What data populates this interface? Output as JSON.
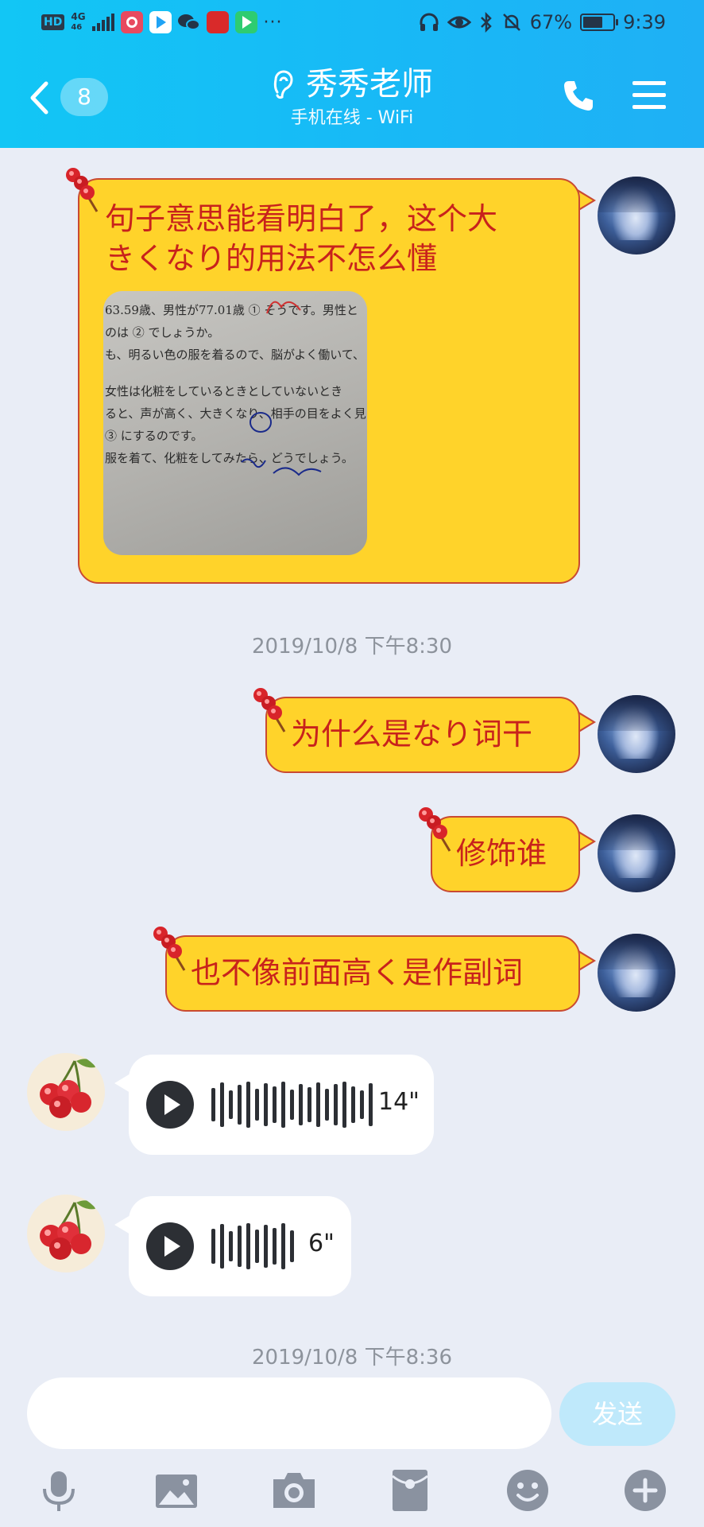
{
  "status_bar": {
    "hd": "HD",
    "network_top": "4G",
    "network_bottom": "46",
    "dots": "···",
    "battery": "67%",
    "battery_level": 0.67,
    "time": "9:39"
  },
  "header": {
    "unread_count": "8",
    "contact_name": "秀秀老师",
    "contact_status": "手机在线 - WiFi"
  },
  "messages": [
    {
      "sender": "me",
      "type": "text_image",
      "text_line1": "句子意思能看明白了，这个大",
      "text_line2": "きくなり的用法不怎么懂",
      "image_lines": [
        "63.59歳、男性が77.01歳 ① そうです。男性と",
        "のは ② でしょうか。",
        "も、明るい色の服を着るので、脳がよく働いて、",
        "女性は化粧をしているときとしていないとき",
        "ると、声が高く、大きくなり、相手の目をよく見",
        "③ にするのです。",
        "服を着て、化粧をしてみたら、どうでしょう。"
      ]
    },
    {
      "sender": "me",
      "type": "text",
      "text": "为什么是なり词干"
    },
    {
      "sender": "me",
      "type": "text",
      "text": "修饰谁"
    },
    {
      "sender": "me",
      "type": "text",
      "text": "也不像前面高く是作副词"
    },
    {
      "sender": "other",
      "type": "voice",
      "duration": "14\""
    },
    {
      "sender": "other",
      "type": "voice",
      "duration": "6\""
    }
  ],
  "timestamps": [
    "2019/10/8 下午8:30",
    "2019/10/8 下午8:36"
  ],
  "input": {
    "placeholder": "",
    "send_label": "发送"
  },
  "colors": {
    "header": "#18b9f6",
    "bubble": "#ffd32a",
    "bubble_text": "#c8221c",
    "background": "#e9edf6"
  },
  "toolbar_icons": [
    "microphone-icon",
    "image-icon",
    "camera-icon",
    "red-packet-icon",
    "emoji-icon",
    "plus-icon"
  ]
}
